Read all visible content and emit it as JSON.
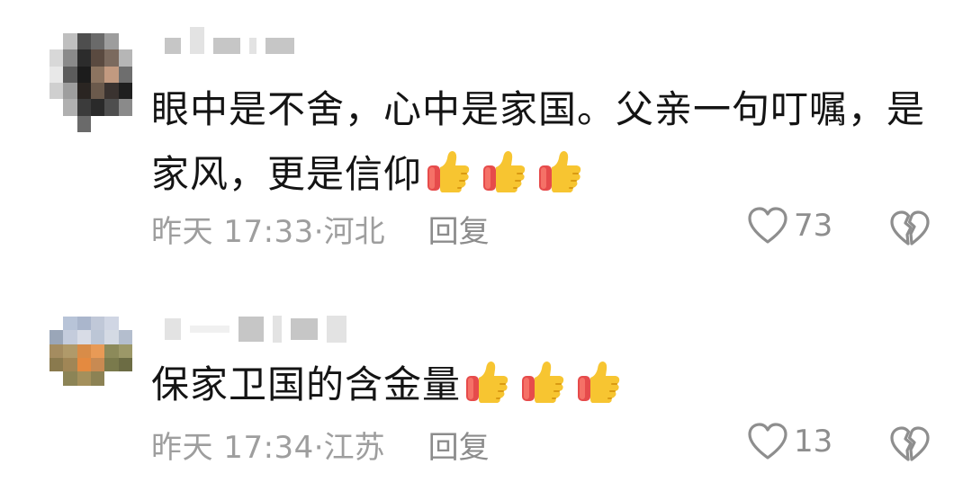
{
  "comments": [
    {
      "text": "眼中是不舍，心中是家国。父亲一句叮嘱，是家风，更是信仰",
      "emoji": [
        "thumbs-up",
        "thumbs-up",
        "thumbs-up"
      ],
      "time": "昨天 17:33",
      "location": "·河北",
      "reply_label": "回复",
      "like_count": "73"
    },
    {
      "text": "保家卫国的含金量",
      "emoji": [
        "thumbs-up",
        "thumbs-up",
        "thumbs-up"
      ],
      "time": "昨天 17:34",
      "location": "·江苏",
      "reply_label": "回复",
      "like_count": "13"
    }
  ],
  "icons": {
    "like": "heart-outline-icon",
    "dislike": "broken-heart-icon",
    "emoji": "thumbs-up-emoji"
  },
  "colors": {
    "text": "#141414",
    "meta": "#9e9e9e",
    "icon": "#8e8e8e",
    "thumb": "#f7c531",
    "cuff": "#e64b4b"
  }
}
